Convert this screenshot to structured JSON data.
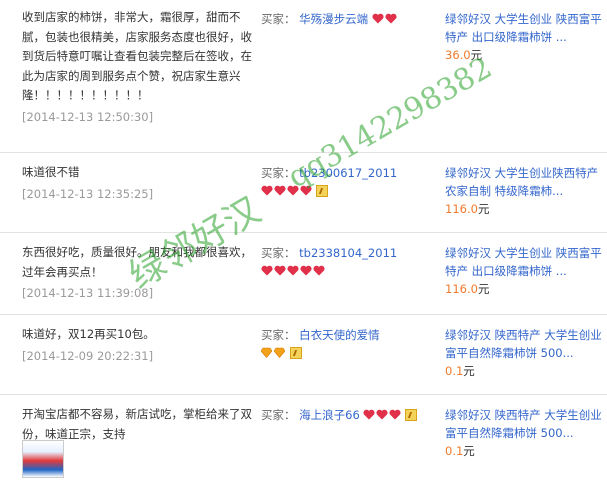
{
  "reviews": [
    {
      "comment": "收到店家的柿饼，非常大，霜很厚，甜而不腻，包装也很精美，店家服务态度也很好，收到货后特意叮嘱让查看包装完整后在签收，在此为店家的周到服务点个赞，祝店家生意兴隆！！！！！！！！！！",
      "date": "[2014-12-13 12:50:30]",
      "buyer_label": "买家：",
      "buyer": "华殇漫步云端",
      "badges": [
        "heart",
        "heart"
      ],
      "product_title": "绿邻好汉 大学生创业 陕西富平特产 出口级降霜柿饼 ...",
      "price": "36.0",
      "unit": "元"
    },
    {
      "comment": "味道很不错",
      "date": "[2014-12-13 12:35:25]",
      "buyer_label": "买家：",
      "buyer": "tb2300617_2011",
      "badges": [
        "heart",
        "heart",
        "heart",
        "heart",
        "vip"
      ],
      "product_title": "绿邻好汉 大学生创业陕西特产农家自制 特级降霜柿...",
      "price": "116.0",
      "unit": "元"
    },
    {
      "comment": "东西很好吃，质量很好。朋友和我都很喜欢，过年会再买点！",
      "date": "[2014-12-13 11:39:08]",
      "buyer_label": "买家：",
      "buyer": "tb2338104_2011",
      "badges": [
        "heart",
        "heart",
        "heart",
        "heart",
        "heart"
      ],
      "product_title": "绿邻好汉 大学生创业 陕西富平特产 出口级降霜柿饼 ...",
      "price": "116.0",
      "unit": "元"
    },
    {
      "comment": "味道好，双12再买10包。",
      "date": "[2014-12-09 20:22:31]",
      "buyer_label": "买家：",
      "buyer": "白衣天使的爱情",
      "badges": [
        "diamond",
        "diamond",
        "vip"
      ],
      "product_title": "绿邻好汉 陕西特产 大学生创业富平自然降霜柿饼 500...",
      "price": "0.1",
      "unit": "元"
    },
    {
      "comment": "开淘宝店都不容易，新店试吃，掌柜给来了双份，味道正宗，支持",
      "date": "",
      "buyer_label": "买家：",
      "buyer": "海上浪子66",
      "badges": [
        "heart",
        "heart",
        "heart",
        "vip"
      ],
      "product_title": "绿邻好汉 陕西特产 大学生创业富平自然降霜柿饼 500...",
      "price": "0.1",
      "unit": "元"
    }
  ],
  "watermark": {
    "line1": "qq3142298382",
    "line2": "绿邻好汉"
  },
  "colors": {
    "link": "#3366cc",
    "price": "#f07a2c",
    "date": "#9a9a9a",
    "heart": "#e0304a",
    "watermark": "#28a028"
  }
}
